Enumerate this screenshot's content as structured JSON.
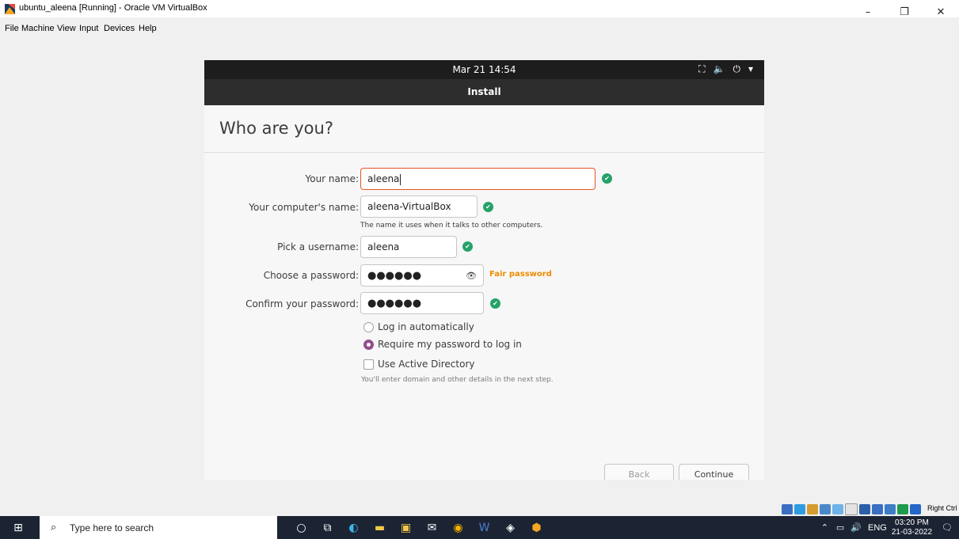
{
  "window": {
    "title": "ubuntu_aleena [Running] - Oracle VM VirtualBox",
    "controls": [
      "–",
      "❐",
      "✕"
    ]
  },
  "menubar": [
    "File",
    "Machine",
    "View",
    "Input",
    "Devices",
    "Help"
  ],
  "guest": {
    "topbar": {
      "datetime": "Mar 21  14:54"
    },
    "headerbar": {
      "title": "Install"
    },
    "page_title": "Who are you?",
    "form": {
      "name_label": "Your name:",
      "name_value": "aleena",
      "computer_label": "Your computer's name:",
      "computer_value": "aleena-VirtualBox",
      "computer_hint": "The name it uses when it talks to other computers.",
      "username_label": "Pick a username:",
      "username_value": "aleena",
      "password_label": "Choose a password:",
      "password_value": "●●●●●●",
      "password_strength": "Fair password",
      "confirm_label": "Confirm your password:",
      "confirm_value": "●●●●●●"
    },
    "options": {
      "auto_login": "Log in automatically",
      "require_password": "Require my password to log in",
      "active_directory": "Use Active Directory",
      "ad_hint": "You'll enter domain and other details in the next step."
    },
    "buttons": {
      "back": "Back",
      "continue": "Continue"
    }
  },
  "statusbar": {
    "host_key": "Right Ctrl"
  },
  "taskbar": {
    "search_placeholder": "Type here to search",
    "tray_lang": "ENG",
    "time": "03:20 PM",
    "date": "21-03-2022"
  },
  "colors": {
    "accent": "#e95420",
    "success": "#26a269",
    "radio": "#924d8b",
    "warning": "#f08c00"
  }
}
